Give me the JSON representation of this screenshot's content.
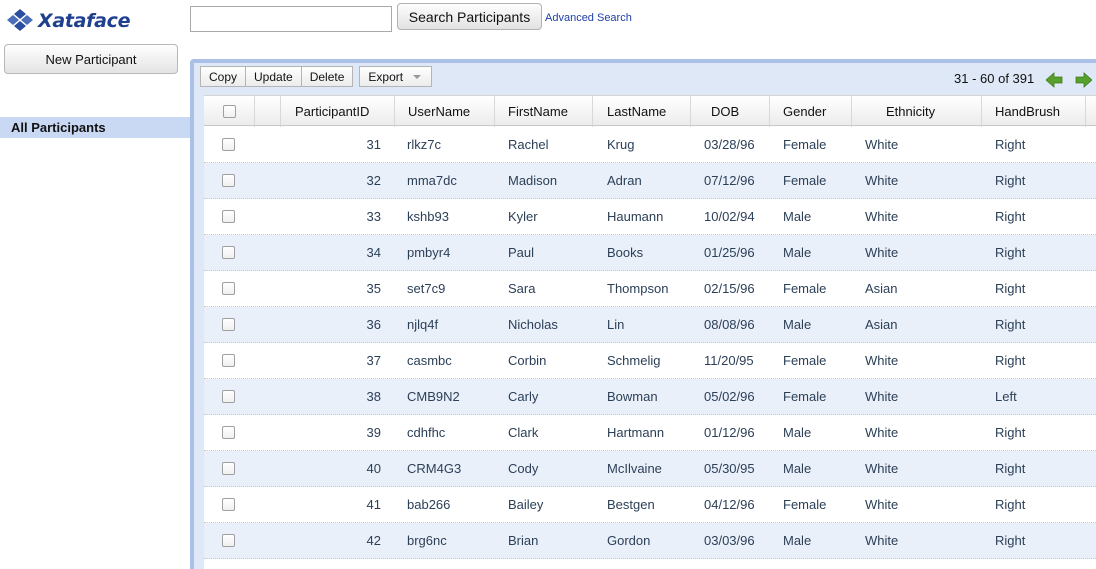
{
  "app": {
    "logo_text": "Xataface"
  },
  "search": {
    "placeholder": "",
    "button_label": "Search Participants",
    "advanced_link": "Advanced Search"
  },
  "sidebar": {
    "new_button": "New Participant",
    "items": [
      {
        "label": "All Participants",
        "selected": true
      }
    ]
  },
  "toolbar": {
    "copy": "Copy",
    "update": "Update",
    "delete": "Delete",
    "export": "Export"
  },
  "pager": {
    "text": "31 - 60 of 391"
  },
  "colors": {
    "accent": "#1f3f8f",
    "selected_bg": "#c9d8f3",
    "row_alt": "#eaf0fa",
    "arrow": "#5aa02c"
  },
  "table": {
    "headers": [
      "ParticipantID",
      "UserName",
      "FirstName",
      "LastName",
      "DOB",
      "Gender",
      "Ethnicity",
      "HandBrush"
    ],
    "rows": [
      [
        "31",
        "rlkz7c",
        "Rachel",
        "Krug",
        "03/28/96",
        "Female",
        "White",
        "Right"
      ],
      [
        "32",
        "mma7dc",
        "Madison",
        "Adran",
        "07/12/96",
        "Female",
        "White",
        "Right"
      ],
      [
        "33",
        "kshb93",
        "Kyler",
        "Haumann",
        "10/02/94",
        "Male",
        "White",
        "Right"
      ],
      [
        "34",
        "pmbyr4",
        "Paul",
        "Books",
        "01/25/96",
        "Male",
        "White",
        "Right"
      ],
      [
        "35",
        "set7c9",
        "Sara",
        "Thompson",
        "02/15/96",
        "Female",
        "Asian",
        "Right"
      ],
      [
        "36",
        "njlq4f",
        "Nicholas",
        "Lin",
        "08/08/96",
        "Male",
        "Asian",
        "Right"
      ],
      [
        "37",
        "casmbc",
        "Corbin",
        "Schmelig",
        "11/20/95",
        "Female",
        "White",
        "Right"
      ],
      [
        "38",
        "CMB9N2",
        "Carly",
        "Bowman",
        "05/02/96",
        "Female",
        "White",
        "Left"
      ],
      [
        "39",
        "cdhfhc",
        "Clark",
        "Hartmann",
        "01/12/96",
        "Male",
        "White",
        "Right"
      ],
      [
        "40",
        "CRM4G3",
        "Cody",
        "McIlvaine",
        "05/30/95",
        "Male",
        "White",
        "Right"
      ],
      [
        "41",
        "bab266",
        "Bailey",
        "Bestgen",
        "04/12/96",
        "Female",
        "White",
        "Right"
      ],
      [
        "42",
        "brg6nc",
        "Brian",
        "Gordon",
        "03/03/96",
        "Male",
        "White",
        "Right"
      ]
    ]
  }
}
